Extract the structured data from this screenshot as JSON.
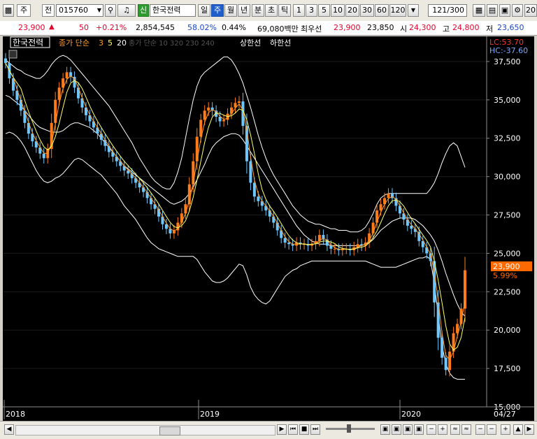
{
  "toolbar": {
    "market_label": "주",
    "type_label": "전",
    "stock_code": "015760",
    "badge": "신",
    "stock_name": "한국전력",
    "periods": [
      "일",
      "주",
      "월",
      "년",
      "분",
      "초",
      "틱"
    ],
    "active_period": "주",
    "intervals": [
      "1",
      "3",
      "5",
      "10",
      "20",
      "30",
      "60",
      "120"
    ],
    "view_count": "121",
    "view_total": "/300",
    "right_num": "20"
  },
  "quote": {
    "price": "23,900",
    "change_arrow": "▲",
    "change": "50",
    "change_pct": "+0.21%",
    "volume": "2,854,545",
    "vol_ratio": "58.02%",
    "turnover": "0.44%",
    "amount": "69,080백만",
    "best_label": "최우선",
    "best_ask": "23,900",
    "best_bid": "23,850",
    "open_label": "시",
    "open": "24,300",
    "high_label": "고",
    "high": "24,800",
    "low_label": "저",
    "low": "23,650"
  },
  "legend": {
    "stock_name": "한국전력",
    "ma_label": "종가 단순",
    "ma_periods": [
      "3",
      "5",
      "20"
    ],
    "ma_long": "종가 단순 10 320 230 240",
    "upper_label": "상한선",
    "lower_label": "하한선"
  },
  "colors": {
    "up": "#ff7a1a",
    "down": "#6fc7ff",
    "ma3": "#ff9a2a",
    "ma5": "#ffff66",
    "band": "#ffffff",
    "price_tag": "#ff6a00"
  },
  "chart_data": {
    "type": "candlestick",
    "ylim": [
      15000,
      38500
    ],
    "yticks": [
      "37,500",
      "35,000",
      "32,500",
      "30,000",
      "27,500",
      "25,000",
      "22,500",
      "20,000",
      "17,500",
      "15,000"
    ],
    "x_labels": [
      "2018",
      "2019",
      "2020",
      "04/27"
    ],
    "lc": "LC:53.70",
    "hc": "HC:-37.60",
    "current_price": "23,900",
    "current_pct": "5.99%",
    "closes": [
      37400,
      36400,
      35600,
      35000,
      34300,
      33500,
      32800,
      32300,
      31900,
      31500,
      31200,
      31800,
      33500,
      35000,
      35800,
      36400,
      36800,
      36500,
      35800,
      35100,
      34500,
      34000,
      33600,
      33200,
      32800,
      32400,
      32000,
      31600,
      31300,
      31000,
      30700,
      30400,
      30200,
      29900,
      29600,
      29300,
      29000,
      28600,
      28200,
      27900,
      27400,
      26900,
      26600,
      26300,
      26500,
      27000,
      27600,
      28200,
      29500,
      31000,
      32600,
      33700,
      34300,
      34500,
      34300,
      33900,
      33600,
      33700,
      34100,
      34500,
      34800,
      34900,
      33300,
      31000,
      29600,
      28700,
      28400,
      28100,
      27800,
      27400,
      27000,
      26500,
      26000,
      25700,
      25600,
      25500,
      25700,
      25600,
      25600,
      25500,
      25600,
      25800,
      26200,
      25900,
      25500,
      25300,
      25300,
      25200,
      25300,
      25300,
      25200,
      25400,
      25600,
      25500,
      25700,
      26300,
      27000,
      27800,
      28200,
      28600,
      28900,
      28600,
      28100,
      27600,
      27200,
      26800,
      26600,
      26400,
      25800,
      25400,
      25000,
      24500,
      21800,
      19500,
      18200,
      17400,
      18600,
      19800,
      20400,
      21400,
      23900
    ],
    "ma20": [
      35300,
      35200,
      35000,
      34800,
      34600,
      34300,
      34000,
      33700,
      33400,
      33200,
      33100,
      33000,
      32900,
      32900,
      32900,
      33000,
      33200,
      33400,
      33500,
      33500,
      33400,
      33300,
      33200,
      33000,
      32800,
      32500,
      32200,
      31900,
      31600,
      31300,
      31000,
      30700,
      30500,
      30300,
      30100,
      29900,
      29700,
      29500,
      29300,
      29100,
      28900,
      28700,
      28500,
      28300,
      28200,
      28300,
      28400,
      28600,
      28900,
      29300,
      29800,
      30300,
      30800,
      31400,
      31900,
      32200,
      32400,
      32600,
      32700,
      32800,
      32800,
      32700,
      32400,
      32000,
      31600,
      31200,
      30800,
      30400,
      30000,
      29600,
      29200,
      28800,
      28400,
      28000,
      27600,
      27200,
      26800,
      26500,
      26200,
      26000,
      25800,
      25700,
      25600,
      25600,
      25600,
      25500,
      25500,
      25500,
      25500,
      25500,
      25500,
      25500,
      25500,
      25500,
      25600,
      25700,
      25900,
      26200,
      26500,
      26700,
      26900,
      27100,
      27200,
      27300,
      27300,
      27300,
      27300,
      27200,
      27000,
      26800,
      26500,
      26200,
      25800,
      25200,
      24500,
      23700,
      23000,
      22300,
      21700,
      21200,
      20900
    ],
    "upper": [
      37600,
      37400,
      37200,
      37000,
      36900,
      36700,
      36600,
      36500,
      36400,
      36400,
      36600,
      36900,
      37300,
      37600,
      37800,
      37900,
      37800,
      37600,
      37300,
      37000,
      36700,
      36400,
      36100,
      35800,
      35500,
      35200,
      34900,
      34600,
      34200,
      33800,
      33400,
      33000,
      32600,
      32200,
      31700,
      31200,
      30800,
      30400,
      30000,
      29700,
      29500,
      29300,
      29200,
      29200,
      29600,
      30300,
      31200,
      32500,
      33800,
      35000,
      35900,
      36500,
      36800,
      37000,
      37200,
      37400,
      37600,
      37800,
      37800,
      37600,
      37200,
      36700,
      36100,
      35300,
      34500,
      33600,
      32700,
      31900,
      31200,
      30600,
      30100,
      29700,
      29300,
      28900,
      28500,
      28100,
      27800,
      27500,
      27300,
      27100,
      27000,
      26900,
      26900,
      26800,
      26700,
      26600,
      26600,
      26500,
      26500,
      26500,
      26400,
      26400,
      26400,
      26500,
      26700,
      27100,
      27600,
      28200,
      28600,
      28800,
      28900,
      28900,
      28900,
      28900,
      28900,
      28900,
      28900,
      28900,
      28900,
      28900,
      28900,
      29200,
      29600,
      30200,
      30900,
      31500,
      32000,
      32200,
      32000,
      31300,
      30600
    ],
    "lower": [
      32800,
      32900,
      32800,
      32600,
      32300,
      31900,
      31400,
      30900,
      30400,
      30000,
      29700,
      29600,
      29700,
      29900,
      30000,
      30200,
      30500,
      30800,
      31100,
      31200,
      31100,
      30900,
      30700,
      30500,
      30300,
      30100,
      29800,
      29500,
      29200,
      28900,
      28500,
      28100,
      27800,
      27500,
      27200,
      26800,
      26400,
      26000,
      25700,
      25500,
      25300,
      25200,
      25100,
      25000,
      24900,
      24800,
      24800,
      24800,
      24800,
      24800,
      24600,
      24200,
      23800,
      23500,
      23200,
      23100,
      23100,
      23200,
      23400,
      23700,
      24000,
      24300,
      24200,
      23600,
      22800,
      22300,
      22000,
      21800,
      21700,
      21900,
      22300,
      22700,
      23100,
      23500,
      23700,
      23900,
      24000,
      24200,
      24300,
      24400,
      24500,
      24500,
      24500,
      24500,
      24500,
      24500,
      24500,
      24500,
      24500,
      24500,
      24500,
      24500,
      24500,
      24500,
      24500,
      24400,
      24300,
      24200,
      24100,
      24100,
      24100,
      24100,
      24100,
      24200,
      24300,
      24400,
      24500,
      24600,
      24700,
      24700,
      24800,
      24600,
      23000,
      21000,
      19000,
      17800,
      17200,
      16900,
      16800,
      16800,
      16800
    ]
  }
}
